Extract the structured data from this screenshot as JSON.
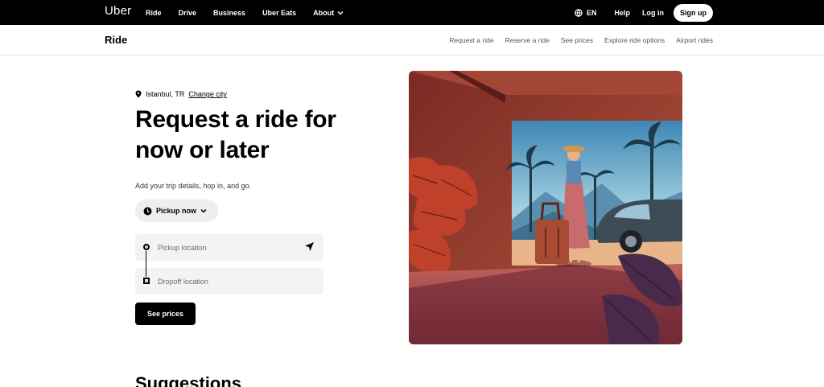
{
  "topnav": {
    "logo": "Uber",
    "links": [
      "Ride",
      "Drive",
      "Business",
      "Uber Eats"
    ],
    "about": "About",
    "language": "EN",
    "help": "Help",
    "login": "Log in",
    "signup": "Sign up"
  },
  "subnav": {
    "title": "Ride",
    "items": [
      "Request a ride",
      "Reserve a ride",
      "See prices",
      "Explore ride options",
      "Airport rides"
    ]
  },
  "hero": {
    "city": "Istanbul, TR",
    "change_city": "Change city",
    "title_line1": "Request a ride for",
    "title_line2": "now or later",
    "subtitle": "Add your trip details, hop in, and go.",
    "pickup_time": "Pickup now",
    "pickup_placeholder": "Pickup location",
    "dropoff_placeholder": "Dropoff location",
    "see_prices": "See prices"
  },
  "suggestions_heading": "Suggestions",
  "icons": {
    "pin": "location-pin-icon",
    "globe": "globe-icon",
    "clock": "clock-icon",
    "chevron": "chevron-down-icon",
    "navigation": "navigation-arrow-icon"
  },
  "colors": {
    "accent": "#000000",
    "field_bg": "#f3f3f3"
  }
}
